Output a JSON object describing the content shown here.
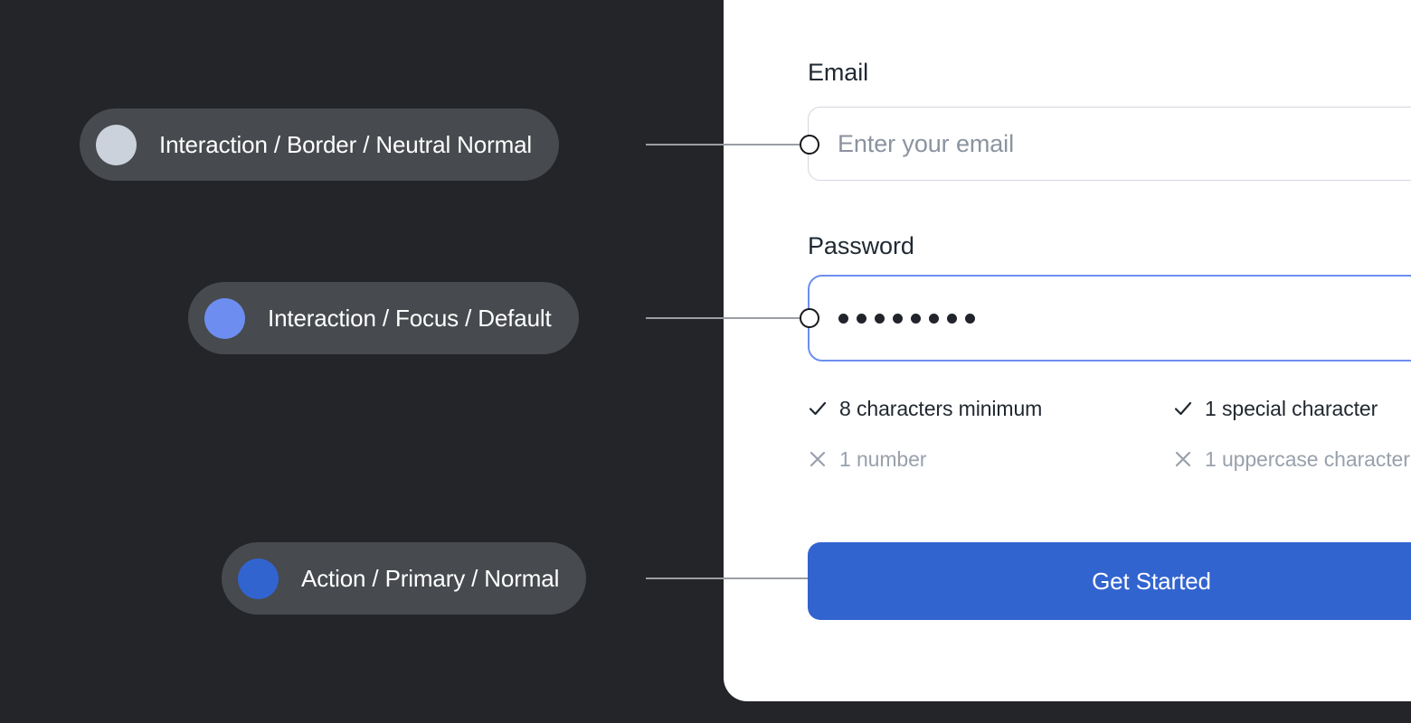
{
  "canvas": {
    "background_color": "#242528"
  },
  "card": {
    "background_color": "#ffffff"
  },
  "form": {
    "email": {
      "label": "Email",
      "placeholder": "Enter your email",
      "value": "",
      "border_color": "#d3d7de"
    },
    "password": {
      "label": "Password",
      "masked_value": "••••••••",
      "dot_count": 8,
      "focus_border_color": "#6d8ef0"
    },
    "password_rules": [
      {
        "text": "8 characters minimum",
        "state": "pass",
        "icon": "check-icon"
      },
      {
        "text": "1 special character",
        "state": "pass",
        "icon": "check-icon"
      },
      {
        "text": "1 number",
        "state": "fail",
        "icon": "close-icon"
      },
      {
        "text": "1 uppercase character",
        "state": "fail",
        "icon": "close-icon"
      }
    ],
    "submit": {
      "label": "Get Started",
      "background_color": "#3264d0"
    }
  },
  "annotations": [
    {
      "token": "Interaction / Border / Neutral Normal",
      "swatch_color": "#cbd2db"
    },
    {
      "token": "Interaction / Focus / Default",
      "swatch_color": "#6d8ef0"
    },
    {
      "token": "Action / Primary / Normal",
      "swatch_color": "#3264d0"
    }
  ]
}
